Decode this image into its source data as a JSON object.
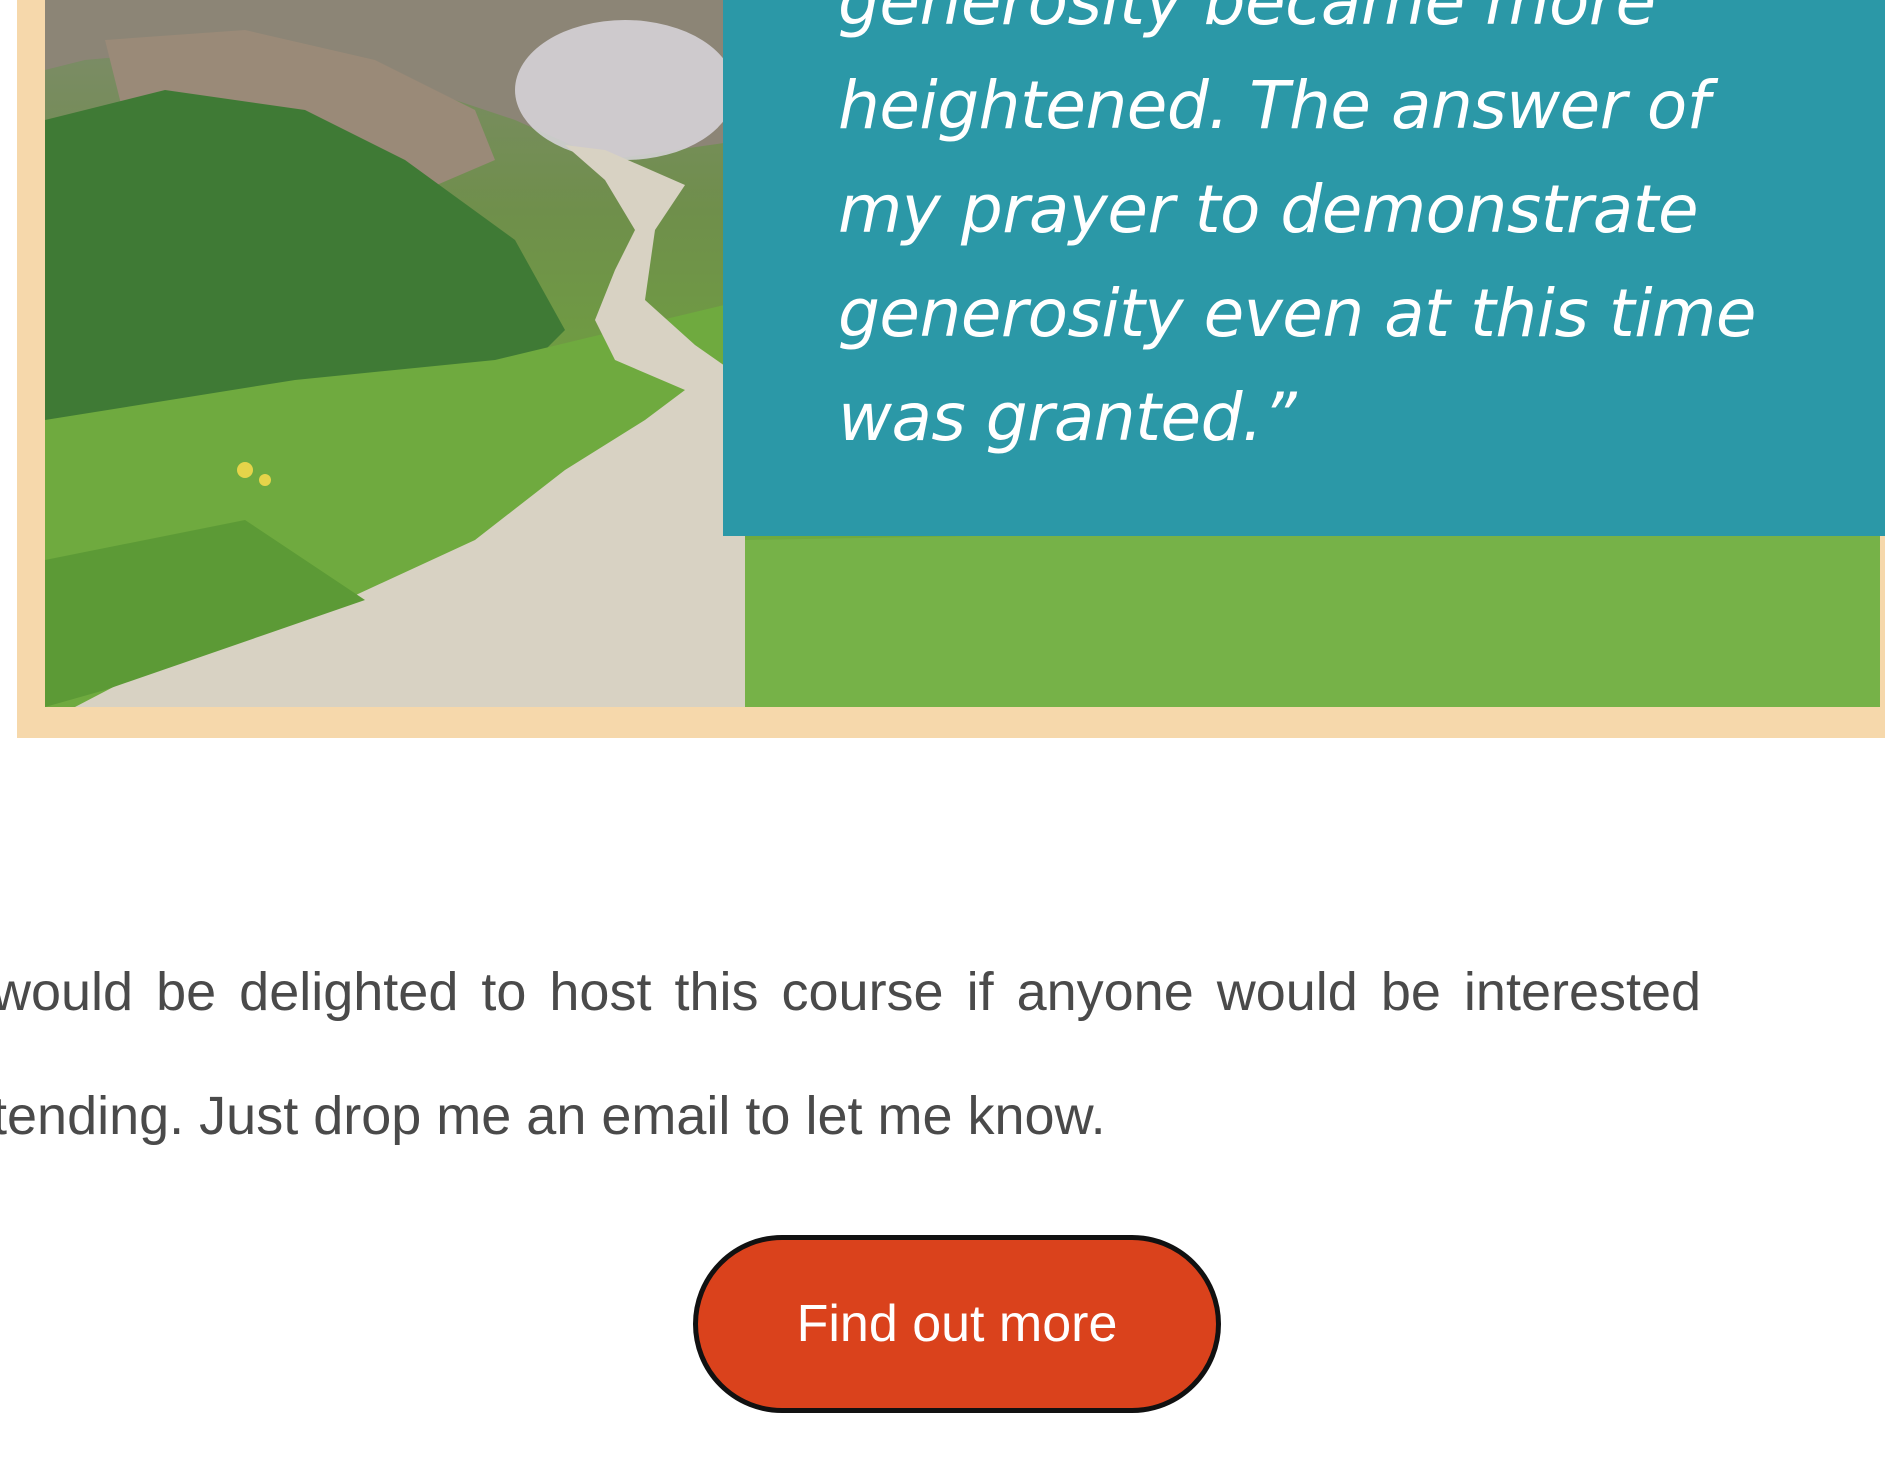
{
  "quote": {
    "lines": [
      "generosity became more",
      "heightened. The answer of",
      "my prayer to demonstrate",
      "generosity even at this time",
      "was granted.”"
    ]
  },
  "body": {
    "lines": [
      "would be delighted to host this course if anyone would be interested",
      "tending. Just drop me an email to let me know."
    ]
  },
  "cta": {
    "label": "Find out more"
  },
  "colors": {
    "frame": "#f6d8ab",
    "quote_bg": "#2b98a7",
    "cta_bg": "#da421c",
    "body_text": "#4a4a4a"
  },
  "image": {
    "subject": "landscape-photo"
  }
}
